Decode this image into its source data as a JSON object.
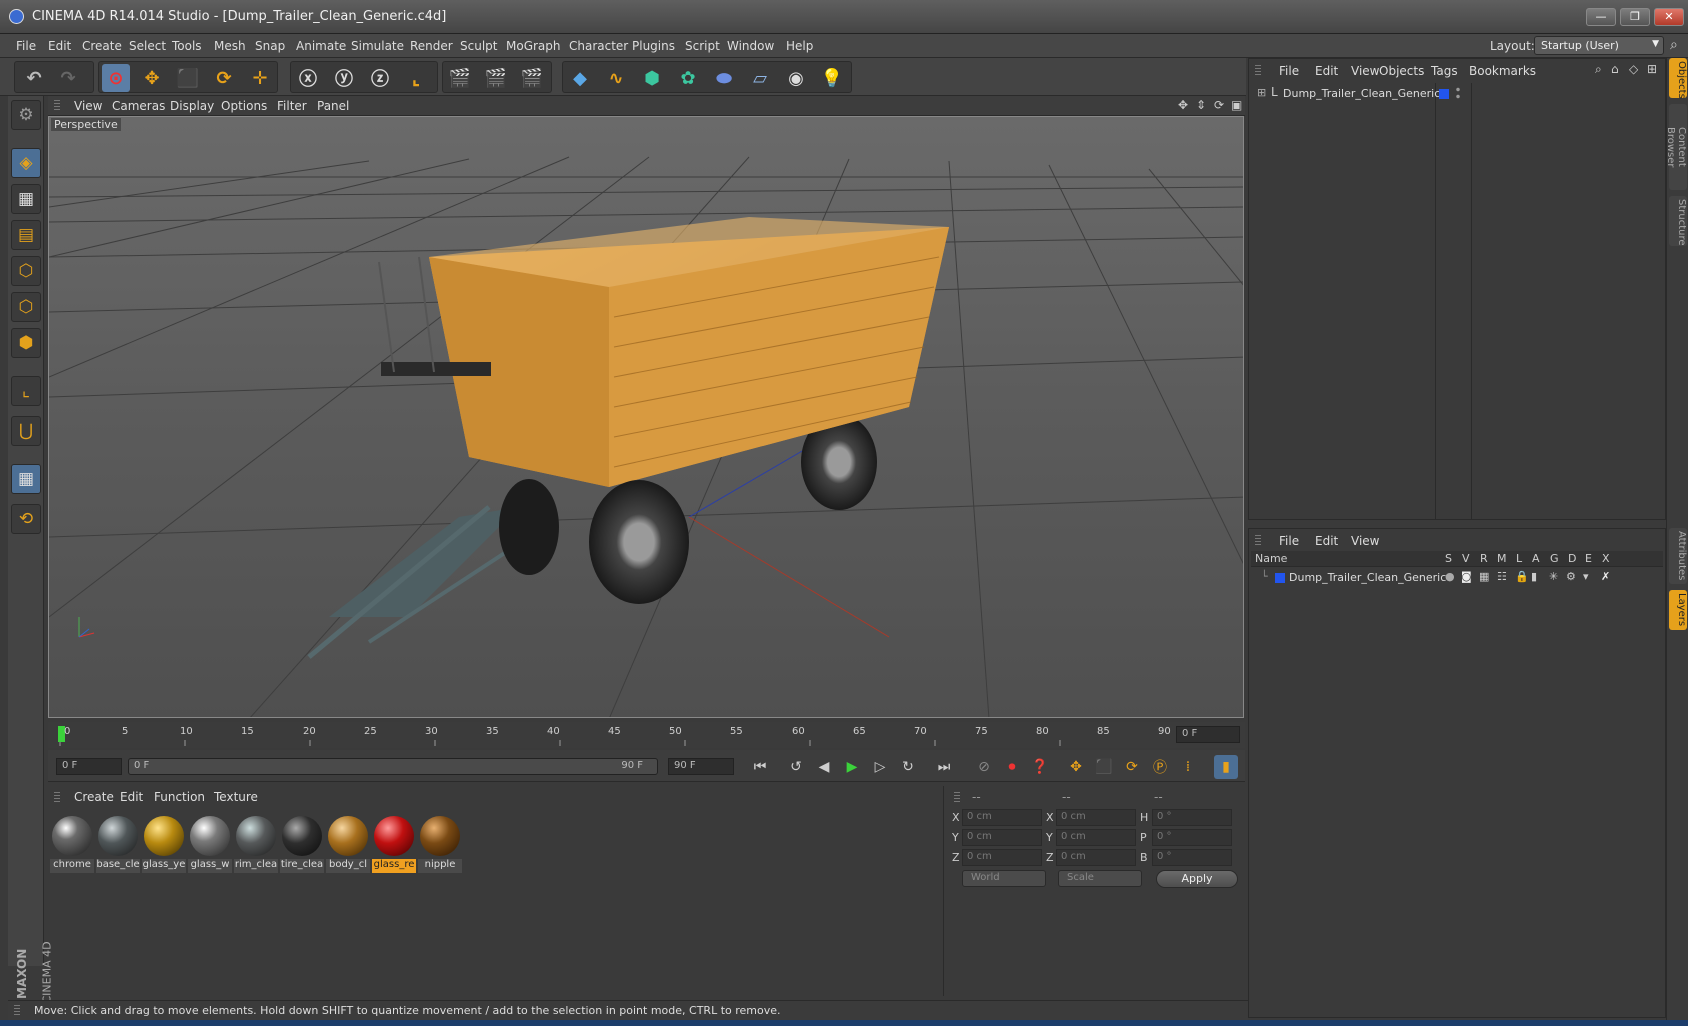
{
  "window": {
    "title": "CINEMA 4D R14.014 Studio - [Dump_Trailer_Clean_Generic.c4d]",
    "btn_min": "—",
    "btn_restore": "❐",
    "btn_close": "✕"
  },
  "menu": [
    "File",
    "Edit",
    "Create",
    "Select",
    "Tools",
    "Mesh",
    "Snap",
    "Animate",
    "Simulate",
    "Render",
    "Sculpt",
    "MoGraph",
    "Character",
    "Plugins",
    "Script",
    "Window",
    "Help"
  ],
  "layout": {
    "label": "Layout:",
    "value": "Startup (User)"
  },
  "viewport": {
    "menu": [
      "View",
      "Cameras",
      "Display",
      "Options",
      "Filter",
      "Panel"
    ],
    "label": "Perspective"
  },
  "timeline": {
    "ticks": [
      "0",
      "5",
      "10",
      "15",
      "20",
      "25",
      "30",
      "35",
      "40",
      "45",
      "50",
      "55",
      "60",
      "65",
      "70",
      "75",
      "80",
      "85",
      "90"
    ],
    "current_frame": "0 F",
    "start_field": "0 F",
    "range_start": "0 F",
    "range_end": "90 F",
    "end_field": "90 F"
  },
  "materials": {
    "menu": [
      "Create",
      "Edit",
      "Function",
      "Texture"
    ],
    "items": [
      {
        "name": "chrome",
        "color": "#6b6b6b"
      },
      {
        "name": "base_cle",
        "color": "#4f5658"
      },
      {
        "name": "glass_ye",
        "color": "#b88a10"
      },
      {
        "name": "glass_w",
        "color": "#7a7a7a"
      },
      {
        "name": "rim_clea",
        "color": "#56595a"
      },
      {
        "name": "tire_clea",
        "color": "#2e2e2e"
      },
      {
        "name": "body_cl",
        "color": "#a8701e"
      },
      {
        "name": "glass_re",
        "color": "#c01010"
      },
      {
        "name": "nipple",
        "color": "#7a4a14"
      }
    ],
    "selected": "glass_re"
  },
  "coords": {
    "headers": [
      "--",
      "--",
      "--"
    ],
    "rows": [
      {
        "l1": "X",
        "v1": "0 cm",
        "l2": "X",
        "v2": "0 cm",
        "l3": "H",
        "v3": "0 °"
      },
      {
        "l1": "Y",
        "v1": "0 cm",
        "l2": "Y",
        "v2": "0 cm",
        "l3": "P",
        "v3": "0 °"
      },
      {
        "l1": "Z",
        "v1": "0 cm",
        "l2": "Z",
        "v2": "0 cm",
        "l3": "B",
        "v3": "0 °"
      }
    ],
    "space": "World",
    "mode": "Scale",
    "apply": "Apply"
  },
  "objects": {
    "menu": [
      "File",
      "Edit",
      "View",
      "Objects",
      "Tags",
      "Bookmarks"
    ],
    "item": "Dump_Trailer_Clean_Generic"
  },
  "layers": {
    "menu": [
      "File",
      "Edit",
      "View"
    ],
    "col_name": "Name",
    "cols": [
      "S",
      "V",
      "R",
      "M",
      "L",
      "A",
      "G",
      "D",
      "E",
      "X"
    ],
    "item": "Dump_Trailer_Clean_Generic"
  },
  "side_tabs": [
    "Objects",
    "Content Browser",
    "Structure",
    "Attributes",
    "Layers"
  ],
  "status": "Move: Click and drag to move elements. Hold down SHIFT to quantize movement / add to the selection in point mode, CTRL to remove.",
  "brand": {
    "maxon": "MAXON",
    "product": "CINEMA 4D"
  }
}
